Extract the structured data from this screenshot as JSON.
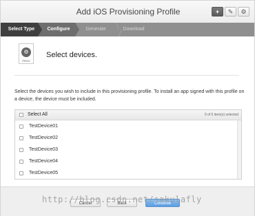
{
  "window": {
    "title": "Add iOS Provisioning Profile"
  },
  "toolbar": {
    "add_label": "+",
    "edit_label": "✎",
    "gear_label": "⚙"
  },
  "steps": [
    {
      "label": "Select Type",
      "state": "done"
    },
    {
      "label": "Configure",
      "state": "active"
    },
    {
      "label": "Generate",
      "state": "upcoming"
    },
    {
      "label": "Download",
      "state": "upcoming"
    }
  ],
  "header": {
    "icon": "provisioning-profile-icon",
    "icon_text": "PROV",
    "title": "Select devices."
  },
  "description": "Select the devices you wish to include in this provisioning profile. To install an app signed with this profile on a device, the device must be included.",
  "table": {
    "select_all_label": "Select All",
    "selection_count": "0 of 5 item(s) selected",
    "devices": [
      {
        "label": "TestDevice01",
        "checked": false
      },
      {
        "label": "TestDevice02",
        "checked": false
      },
      {
        "label": "TestDevice03",
        "checked": false
      },
      {
        "label": "TestDevice04",
        "checked": false
      },
      {
        "label": "TestDevice05",
        "checked": false
      }
    ]
  },
  "footer": {
    "cancel_label": "Cancel",
    "back_label": "Back",
    "continue_label": "Continue"
  },
  "watermark": "http://blog.csdn.net/sakulafly",
  "colors": {
    "accent": "#5c9ce2",
    "step_done": "#3f3f3f",
    "step_active": "#6e6e6e",
    "step_bar": "#8f8f8f"
  }
}
